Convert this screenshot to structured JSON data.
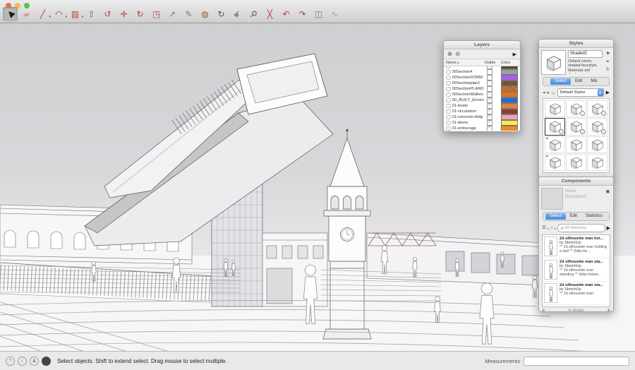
{
  "toolbar": {
    "tools": [
      {
        "name": "select",
        "glyph": "▶",
        "color": "#1c1c1c",
        "rot": -135,
        "selected": true
      },
      {
        "name": "eraser",
        "glyph": "▰",
        "color": "#e49a96"
      },
      {
        "name": "line",
        "glyph": "╱",
        "color": "#b5392b",
        "dropdown": true
      },
      {
        "name": "arc",
        "glyph": "◠",
        "color": "#b5392b",
        "dropdown": true
      },
      {
        "name": "rectangle",
        "glyph": "▨",
        "color": "#b5493a",
        "dropdown": true
      },
      {
        "name": "push-pull",
        "glyph": "⇧",
        "color": "#a8453a"
      },
      {
        "name": "follow-me",
        "glyph": "↺",
        "color": "#b5493a"
      },
      {
        "name": "move",
        "glyph": "✛",
        "color": "#b5392b"
      },
      {
        "name": "rotate",
        "glyph": "↻",
        "color": "#b5392b"
      },
      {
        "name": "scale",
        "glyph": "◳",
        "color": "#b5493a"
      },
      {
        "name": "tape-measure",
        "glyph": "⊸",
        "color": "#6d6d6d",
        "rot": -45
      },
      {
        "name": "text",
        "glyph": "✎",
        "color": "#777777"
      },
      {
        "name": "paint-bucket",
        "glyph": "◍",
        "color": "#9a5a35"
      },
      {
        "name": "orbit",
        "glyph": "↻",
        "color": "#7a4a32"
      },
      {
        "name": "pan",
        "glyph": "☛",
        "color": "#8a8a8a",
        "rot": -45
      },
      {
        "name": "zoom",
        "glyph": "⚲",
        "color": "#555555",
        "rot": 45
      },
      {
        "name": "zoom-extents",
        "glyph": "╳",
        "color": "#b5392b"
      },
      {
        "name": "previous",
        "glyph": "↶",
        "color": "#a8453a"
      },
      {
        "name": "look-around",
        "glyph": "↷",
        "color": "#a8453a"
      },
      {
        "name": "section-plane",
        "glyph": "◫",
        "color": "#8a7a72"
      },
      {
        "name": "walk",
        "glyph": "∿",
        "color": "#cf8a7a"
      }
    ]
  },
  "layers_panel": {
    "title": "Layers",
    "icons": {
      "add": "⊕",
      "remove": "⊖",
      "details": "▶",
      "sort": "▴"
    },
    "columns": [
      "Name",
      "Visible",
      "Color"
    ],
    "rows": [
      {
        "name": "",
        "visible": false,
        "color": "#5d4037",
        "pattern": "solid",
        "partial": true
      },
      {
        "name": "00Section4",
        "visible": false,
        "color": "#9e9e9e",
        "pattern": "solid"
      },
      {
        "name": "00SectionDORM",
        "visible": false,
        "color": "#a85cf0",
        "pattern": "solid"
      },
      {
        "name": "00Sectionplan1",
        "visible": false,
        "color": "#6b4632",
        "pattern": "noise"
      },
      {
        "name": "00SectionPLAND",
        "visible": false,
        "color": "#e0761f",
        "pattern": "hatch"
      },
      {
        "name": "00SectionWalkes",
        "visible": false,
        "color": "#e0761f",
        "pattern": "dots"
      },
      {
        "name": "00_BUILT_Enviro",
        "visible": true,
        "color": "#1e6fd2",
        "pattern": "solid"
      },
      {
        "name": "01-boats",
        "visible": true,
        "color": "#e2813c",
        "pattern": "solid"
      },
      {
        "name": "01-circulation",
        "visible": true,
        "color": "#8e2a1c",
        "pattern": "noise"
      },
      {
        "name": "01-concrete-bldg",
        "visible": true,
        "color": "#f2a0b6",
        "pattern": "solid"
      },
      {
        "name": "01-doors",
        "visible": true,
        "color": "#ffe94d",
        "pattern": "solid"
      },
      {
        "name": "01-entourage",
        "visible": true,
        "color": "#ef8a1f",
        "pattern": "solid"
      }
    ]
  },
  "styles_panel": {
    "title": "Styles",
    "style_name": "Shaded2",
    "description": "Default colors, shaded facestyle. Materials will display as average color.",
    "icons": {
      "tag": "⚑",
      "brush": "✒",
      "refresh": "↻",
      "back": "◂",
      "forward": "▸",
      "home": "⌂",
      "details": "▶",
      "dd_up": "▲",
      "dd_down": "▼"
    },
    "tabs": [
      {
        "label": "Select",
        "active": true
      },
      {
        "label": "Edit",
        "active": false
      },
      {
        "label": "Mix",
        "active": false
      }
    ],
    "dropdown_value": "Default Styles",
    "thumbnails": [
      {
        "selected": false,
        "badge": false,
        "dot": false
      },
      {
        "selected": false,
        "badge": true,
        "dot": false
      },
      {
        "selected": false,
        "badge": true,
        "dot": false
      },
      {
        "selected": true,
        "badge": true,
        "dot": false
      },
      {
        "selected": false,
        "badge": true,
        "dot": false
      },
      {
        "selected": false,
        "badge": true,
        "dot": false
      },
      {
        "selected": false,
        "badge": false,
        "dot": true
      },
      {
        "selected": false,
        "badge": false,
        "dot": false
      },
      {
        "selected": false,
        "badge": false,
        "dot": false
      },
      {
        "selected": false,
        "badge": false,
        "dot": true
      },
      {
        "selected": false,
        "badge": false,
        "dot": false
      },
      {
        "selected": false,
        "badge": false,
        "dot": false
      }
    ]
  },
  "components_panel": {
    "title": "Components",
    "name_placeholder": "Name",
    "description_placeholder": "Description",
    "icons": {
      "badge": "▣",
      "views": "☰",
      "home": "⌂",
      "details": "▶",
      "nav_left": "◈",
      "nav_right": "◈",
      "search": "⚲"
    },
    "tabs": [
      {
        "label": "Select",
        "active": true
      },
      {
        "label": "Edit",
        "active": false
      },
      {
        "label": "Statistics",
        "active": false
      }
    ],
    "search_placeholder": "3D Warehou",
    "items": [
      {
        "title": "2d silhouette man hol...",
        "author": "by SketchUp",
        "description": "** 2d silhouette man holding a ball ** (http://w..."
      },
      {
        "title": "2d silhouette man sta...",
        "author": "by SketchUp",
        "description": "** 2d silhouette man standing ** (http://www..."
      },
      {
        "title": "2d silhouette man sta...",
        "author": "by SketchUp",
        "description": "** 2d silhouette man"
      }
    ],
    "footer": "In Model"
  },
  "status_bar": {
    "icons": [
      {
        "name": "help",
        "glyph": "?",
        "filled": false
      },
      {
        "name": "info",
        "glyph": "i",
        "filled": false
      },
      {
        "name": "person",
        "glyph": "♟",
        "filled": false
      },
      {
        "name": "context",
        "glyph": "",
        "filled": true
      }
    ],
    "hint": "Select objects. Shift to extend select. Drag mouse to select multiple.",
    "measurements_label": "Measurements",
    "measurements_value": ""
  }
}
